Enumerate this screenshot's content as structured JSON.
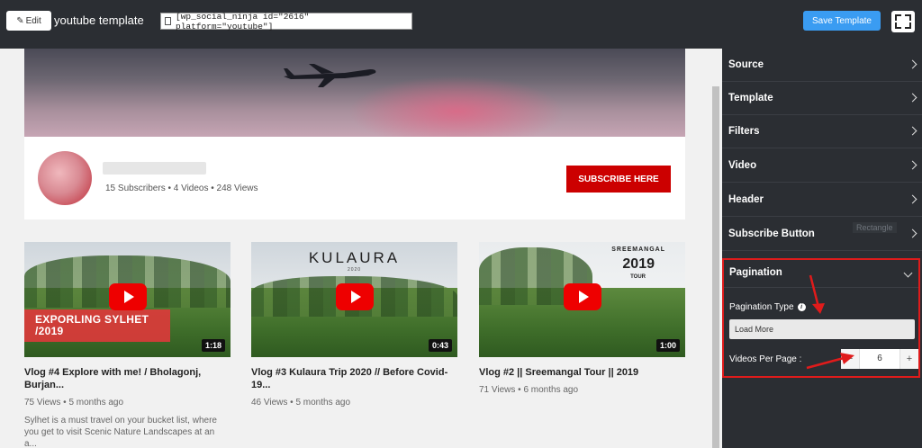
{
  "header": {
    "edit_label": "Edit",
    "template_title": "youtube template",
    "shortcode": "[wp_social_ninja id=\"2616\" platform=\"youtube\"]",
    "save_label": "Save Template"
  },
  "channel": {
    "stats": "15 Subscribers • 4 Videos • 248 Views",
    "subscribe_label": "SUBSCRIBE HERE"
  },
  "videos": [
    {
      "overlay": "EXPORLING SYLHET /2019",
      "duration": "1:18",
      "title": "Vlog #4 Explore with me! / Bholagonj, Burjan...",
      "meta": "75 Views • 5 months ago",
      "desc": "Sylhet is a must travel on your bucket list, where you get to visit Scenic Nature Landscapes at an a..."
    },
    {
      "overlay_title": "KULAURA",
      "overlay_sub": "2020",
      "duration": "0:43",
      "title": "Vlog #3 Kulaura Trip 2020 // Before Covid-19...",
      "meta": "46 Views • 5 months ago"
    },
    {
      "overlay_top": "SREEMANGAL",
      "overlay_year": "2019",
      "overlay_bottom": "TOUR",
      "duration": "1:00",
      "title": "Vlog #2 || Sreemangal Tour || 2019",
      "meta": "71 Views • 6 months ago"
    }
  ],
  "sidebar": {
    "items": [
      "Source",
      "Template",
      "Filters",
      "Video",
      "Header",
      "Subscribe Button"
    ],
    "tooltip": "Rectangle",
    "pagination": {
      "title": "Pagination",
      "type_label": "Pagination Type",
      "type_value": "Load More",
      "per_page_label": "Videos Per Page :",
      "per_page_value": "6",
      "minus": "−",
      "plus": "+"
    }
  },
  "colors": {
    "topbar": "#2b2e33",
    "accent": "#3a9cf2",
    "subscribe": "#cc0000",
    "highlight": "#e01b1b"
  }
}
